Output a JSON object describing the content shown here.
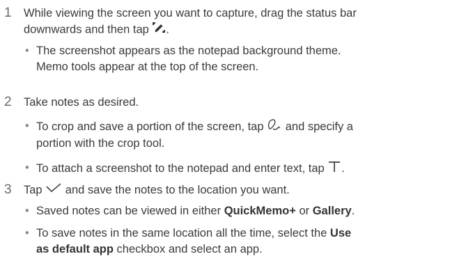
{
  "steps": [
    {
      "number": "1",
      "text_a": "While viewing the screen you want to capture, drag the status bar",
      "text_b": "downwards and then tap",
      "icon": "edit-screenshot-icon",
      "bullets": [
        {
          "line1": "The screenshot appears as the notepad background theme.",
          "line2": "Memo tools appear at the top of the screen."
        }
      ]
    },
    {
      "number": "2",
      "text": "Take notes as desired.",
      "bullets": [
        {
          "pre": "To crop and save a portion of the screen, tap",
          "icon": "crop-lasso-icon",
          "post": "and specify a",
          "line2": "portion with the crop tool."
        },
        {
          "pre": "To attach a screenshot to the notepad and enter text, tap",
          "icon": "text-icon",
          "post": "."
        }
      ]
    },
    {
      "number": "3",
      "pre": "Tap",
      "icon": "checkmark-icon",
      "post": "and save the notes to the location you want.",
      "bullets": [
        {
          "pre": "Saved notes can be viewed in either",
          "bold1": "QuickMemo+",
          "mid": "or",
          "bold2": "Gallery",
          "post": "."
        },
        {
          "pre": "To save notes in the same location all the time, select the",
          "bold1": "Use",
          "bold2": "as default app",
          "post": "checkbox and select an app."
        }
      ]
    }
  ],
  "bullet_glyph": "•"
}
